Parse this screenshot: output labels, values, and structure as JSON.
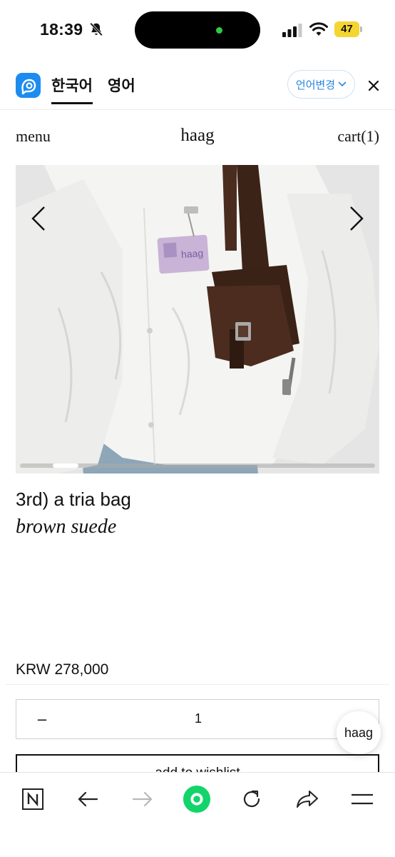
{
  "status_bar": {
    "time": "18:39",
    "battery_level": "47",
    "icons": [
      "bell-slash-icon",
      "signal-icon",
      "wifi-icon",
      "battery-icon"
    ]
  },
  "translator": {
    "tab_korean": "한국어",
    "tab_english": "영어",
    "change_language": "언어변경",
    "colors": {
      "accent": "#1d8cf0",
      "link": "#2a86e0"
    }
  },
  "site": {
    "menu": "menu",
    "brand": "haag",
    "cart": "cart(1)"
  },
  "product": {
    "name": "3rd) a tria bag",
    "variant": "brown suede",
    "price": "KRW 278,000",
    "quantity": "1",
    "quantity_minus": "–",
    "wishlist": "add to wishlist",
    "image_gallery_position": 0.1
  },
  "floating_chat": {
    "label": "haag"
  },
  "browser_toolbar": {
    "items": [
      "naver-icon",
      "back-icon",
      "forward-icon",
      "green-dot-icon",
      "reload-icon",
      "share-icon",
      "menu-icon"
    ],
    "colors": {
      "green": "#12d46a"
    }
  }
}
